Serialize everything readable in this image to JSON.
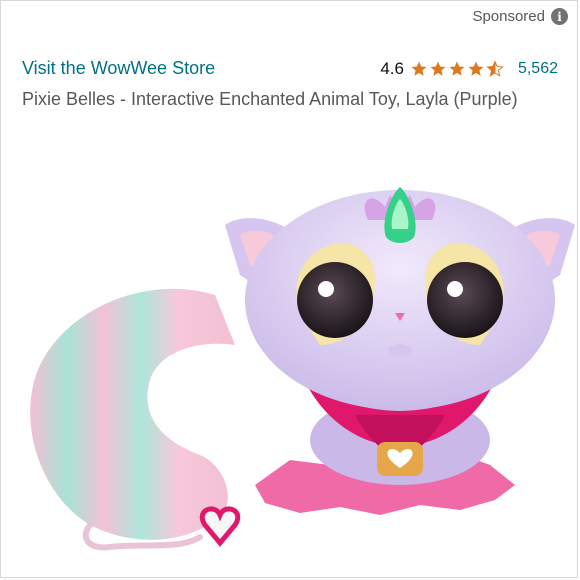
{
  "sponsored": {
    "label": "Sponsored",
    "icon": "info-icon"
  },
  "store": {
    "link_text": "Visit the WowWee Store"
  },
  "rating": {
    "value": "4.6",
    "stars": 4.6,
    "count": "5,562",
    "star_color": "#de7921"
  },
  "product": {
    "title": "Pixie Belles - Interactive Enchanted Animal Toy, Layla (Purple)",
    "colors": {
      "link": "#007185",
      "subtle": "#565959"
    }
  }
}
